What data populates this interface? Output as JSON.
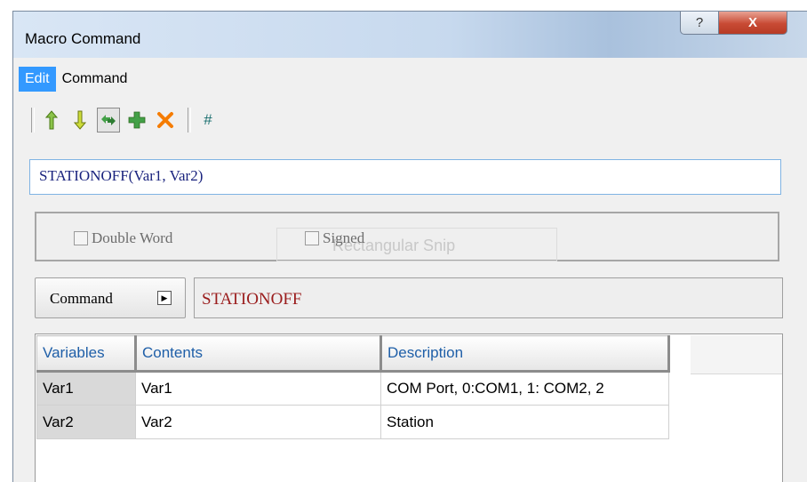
{
  "window": {
    "title": "Macro Command",
    "help_glyph": "?",
    "close_glyph": "X"
  },
  "menu": [
    {
      "label": "Edit",
      "active": true
    },
    {
      "label": "Command",
      "active": false
    }
  ],
  "toolbar": {
    "icons": [
      "move-up-icon",
      "move-down-icon",
      "replace-icon",
      "add-icon",
      "delete-icon"
    ],
    "hash_label": "#"
  },
  "expression": "STATIONOFF(Var1, Var2)",
  "options": {
    "double_word": {
      "label": "Double Word",
      "checked": false
    },
    "signed": {
      "label": "Signed",
      "checked": false
    },
    "ghost_text": "Rectangular Snip"
  },
  "command": {
    "button_label": "Command",
    "value": "STATIONOFF"
  },
  "table": {
    "columns": [
      "Variables",
      "Contents",
      "Description"
    ],
    "rows": [
      {
        "variable": "Var1",
        "content": "Var1",
        "description": "COM Port, 0:COM1, 1: COM2, 2"
      },
      {
        "variable": "Var2",
        "content": "Var2",
        "description": "Station"
      }
    ]
  },
  "colors": {
    "menu_active": "#3399ff",
    "command_text": "#9a1c1c",
    "expression_text": "#1a237e",
    "header_text": "#1f5fa8"
  }
}
